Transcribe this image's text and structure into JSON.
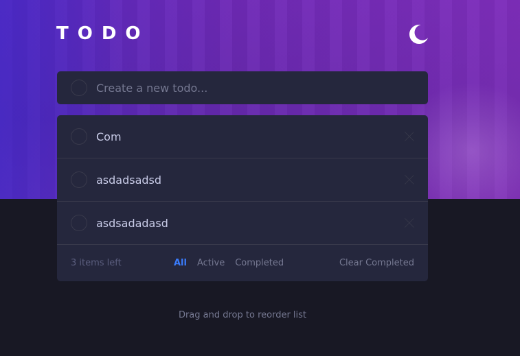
{
  "header": {
    "title": "TODO",
    "theme_icon": "moon-icon"
  },
  "new_todo": {
    "placeholder": "Create a new todo...",
    "value": ""
  },
  "items": [
    {
      "text": "Com",
      "completed": false
    },
    {
      "text": "asdadsadsd",
      "completed": false
    },
    {
      "text": "asdsadadasd",
      "completed": false
    }
  ],
  "footer": {
    "items_left": "3 items left",
    "filters": [
      "All",
      "Active",
      "Completed"
    ],
    "active_filter": "All",
    "clear_label": "Clear Completed"
  },
  "hint": "Drag and drop to reorder list",
  "colors": {
    "accent": "#3a7cfd",
    "card": "#25273d",
    "background": "#181824"
  }
}
